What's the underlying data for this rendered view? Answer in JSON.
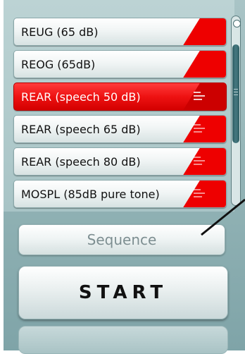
{
  "measurements": [
    {
      "label": "REUG (65 dB)",
      "selected": false,
      "has_lines": false
    },
    {
      "label": "REOG (65dB)",
      "selected": false,
      "has_lines": false
    },
    {
      "label": "REAR (speech 50 dB)",
      "selected": true,
      "has_lines": true
    },
    {
      "label": "REAR (speech 65 dB)",
      "selected": false,
      "has_lines": true
    },
    {
      "label": "REAR (speech 80 dB)",
      "selected": false,
      "has_lines": true
    },
    {
      "label": "MOSPL (85dB pure tone)",
      "selected": false,
      "has_lines": true
    }
  ],
  "buttons": {
    "sequence_label": "Sequence",
    "start_label": "START"
  },
  "colors": {
    "selected_red": "#ee1212",
    "tab_red": "#ee0000",
    "panel_teal": "#97b7b9"
  }
}
